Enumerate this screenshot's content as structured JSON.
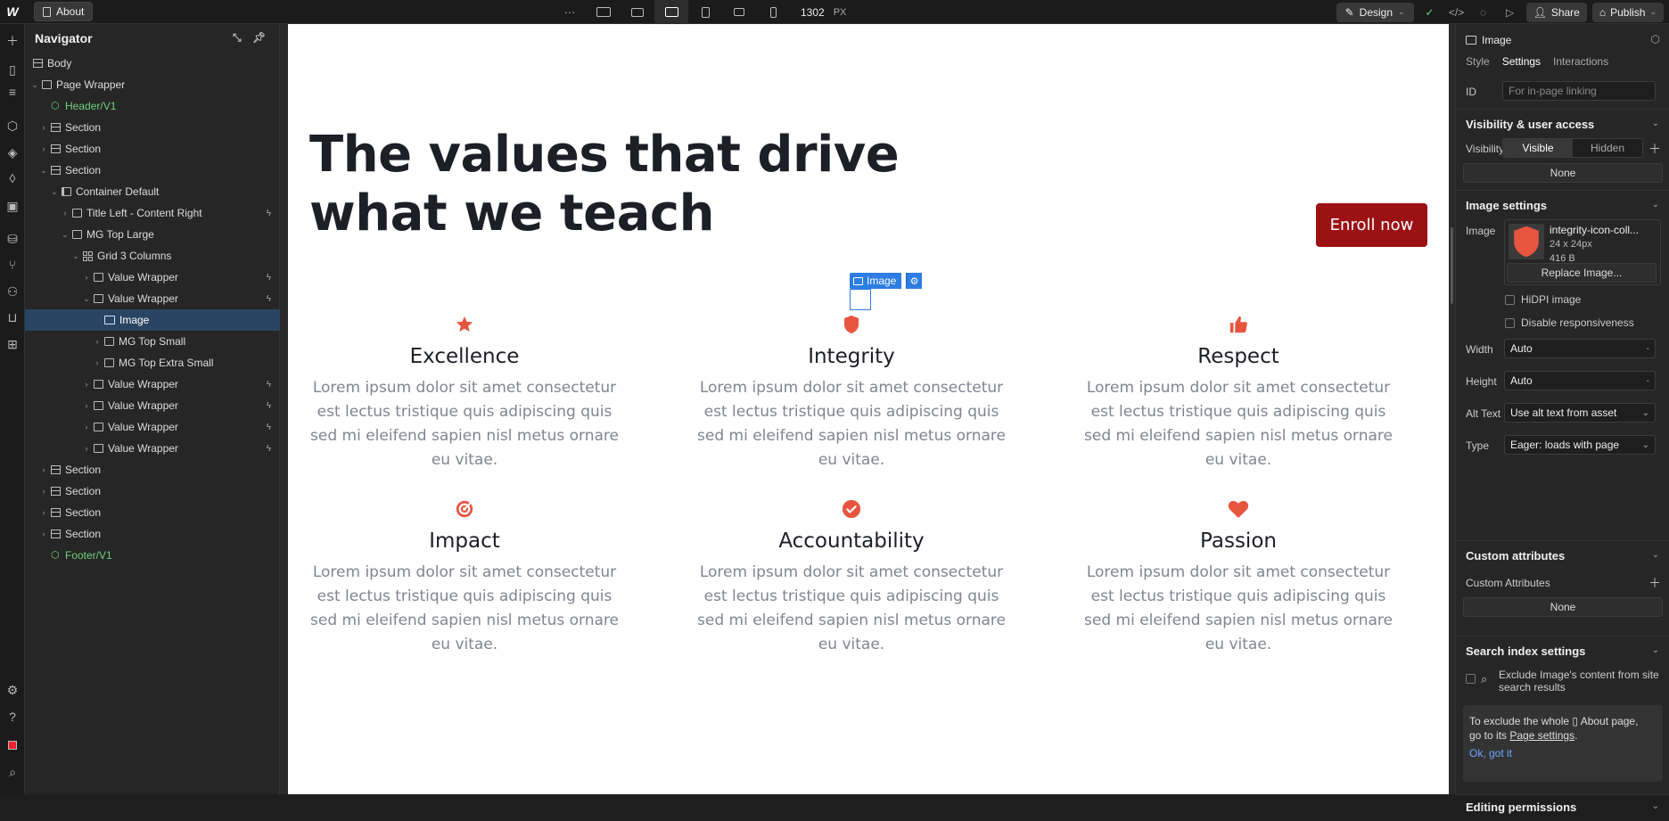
{
  "topbar": {
    "logo": "W",
    "page_name": "About",
    "more": "···",
    "canvas_width": "1302",
    "unit": "PX",
    "design_label": "Design",
    "share_label": "Share",
    "publish_label": "Publish"
  },
  "navigator": {
    "title": "Navigator",
    "items": [
      {
        "label": "Body"
      },
      {
        "label": "Page Wrapper"
      },
      {
        "label": "Header/V1"
      },
      {
        "label": "Section"
      },
      {
        "label": "Section"
      },
      {
        "label": "Section"
      },
      {
        "label": "Container Default"
      },
      {
        "label": "Title Left - Content Right"
      },
      {
        "label": "MG Top Large"
      },
      {
        "label": "Grid 3 Columns"
      },
      {
        "label": "Value Wrapper"
      },
      {
        "label": "Value Wrapper"
      },
      {
        "label": "Image"
      },
      {
        "label": "MG Top Small"
      },
      {
        "label": "MG Top Extra Small"
      },
      {
        "label": "Value Wrapper"
      },
      {
        "label": "Value Wrapper"
      },
      {
        "label": "Value Wrapper"
      },
      {
        "label": "Value Wrapper"
      },
      {
        "label": "Section"
      },
      {
        "label": "Section"
      },
      {
        "label": "Section"
      },
      {
        "label": "Section"
      },
      {
        "label": "Footer/V1"
      }
    ]
  },
  "canvas": {
    "headline": "The values that drive what we teach",
    "cta": "Enroll now",
    "accent": "#e8553f",
    "values": [
      {
        "title": "Excellence",
        "desc": "Lorem ipsum dolor sit amet consectetur est lectus tristique quis adipiscing quis sed mi eleifend sapien nisl metus ornare eu vitae.",
        "icon": "star-icon"
      },
      {
        "title": "Integrity",
        "desc": "Lorem ipsum dolor sit amet consectetur est lectus tristique quis adipiscing quis sed mi eleifend sapien nisl metus ornare eu vitae.",
        "icon": "shield-icon"
      },
      {
        "title": "Respect",
        "desc": "Lorem ipsum dolor sit amet consectetur est lectus tristique quis adipiscing quis sed mi eleifend sapien nisl metus ornare eu vitae.",
        "icon": "thumbs-up-icon"
      },
      {
        "title": "Impact",
        "desc": "Lorem ipsum dolor sit amet consectetur est lectus tristique quis adipiscing quis sed mi eleifend sapien nisl metus ornare eu vitae.",
        "icon": "target-icon"
      },
      {
        "title": "Accountability",
        "desc": "Lorem ipsum dolor sit amet consectetur est lectus tristique quis adipiscing quis sed mi eleifend sapien nisl metus ornare eu vitae.",
        "icon": "check-circle-icon"
      },
      {
        "title": "Passion",
        "desc": "Lorem ipsum dolor sit amet consectetur est lectus tristique quis adipiscing quis sed mi eleifend sapien nisl metus ornare eu vitae.",
        "icon": "heart-icon"
      }
    ],
    "selection_label": "Image"
  },
  "panel": {
    "element": "Image",
    "tabs": [
      "Style",
      "Settings",
      "Interactions"
    ],
    "id_label": "ID",
    "id_placeholder": "For in-page linking",
    "visibility_title": "Visibility & user access",
    "visibility_label": "Visibility",
    "visible": "Visible",
    "hidden": "Hidden",
    "none_1": "None",
    "image_settings_title": "Image settings",
    "image_label": "Image",
    "file_name": "integrity-icon-coll...",
    "file_dims": "24 x 24px",
    "file_size": "416 B",
    "replace": "Replace Image...",
    "hidpi": "HiDPI image",
    "disable_resp": "Disable responsiveness",
    "width_label": "Width",
    "width_value": "Auto",
    "height_label": "Height",
    "height_value": "Auto",
    "alt_label": "Alt Text",
    "alt_value": "Use alt text from asset",
    "type_label": "Type",
    "type_value": "Eager: loads with page",
    "custom_attr_title": "Custom attributes",
    "custom_attr_label": "Custom Attributes",
    "none_2": "None",
    "search_title": "Search index settings",
    "exclude_text": "Exclude Image's content from site search results",
    "info_1": "To exclude the whole",
    "info_page": "About page,",
    "info_2": "go to its",
    "info_link": "Page settings",
    "info_ok": "Ok, got it",
    "editing_title": "Editing permissions",
    "dash": "-"
  }
}
